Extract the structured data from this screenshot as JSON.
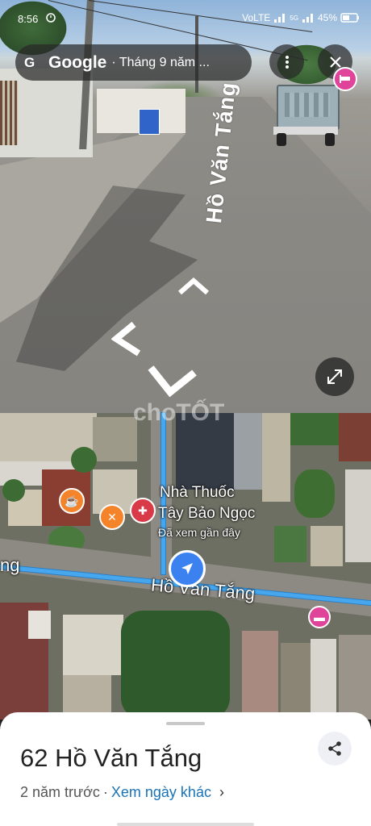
{
  "status_bar": {
    "time": "8:56",
    "network": "VoLTE",
    "signal_label": "5G",
    "battery": "45%"
  },
  "street_view": {
    "brand": "Google",
    "breadcrumb": "· Tháng 9 năm ...",
    "road_sign": "Hồ Văn Tắng",
    "more_icon": "more-vert-icon",
    "close_icon": "close-icon",
    "expand_icon": "expand-icon"
  },
  "map": {
    "poi_name_line1": "Nhà Thuốc",
    "poi_name_line2": "Tây Bảo Ngọc",
    "poi_note": "Đã xem gần đây",
    "street_label": "Hồ Văn Tắng",
    "street_label_left": "ng",
    "watermark": "choTỐT",
    "poi_icons": [
      "coffee-icon",
      "restaurant-icon",
      "pharmacy-icon",
      "hotel-icon"
    ],
    "colors": {
      "route": "#46a7ee",
      "you_marker": "#3b82f0",
      "hotel": "#e0449a",
      "food": "#f5832a"
    }
  },
  "sheet": {
    "address": "62 Hồ Văn Tắng",
    "when": "2 năm trước",
    "separator": "·",
    "other_dates": "Xem ngày khác",
    "chevron": "›"
  }
}
